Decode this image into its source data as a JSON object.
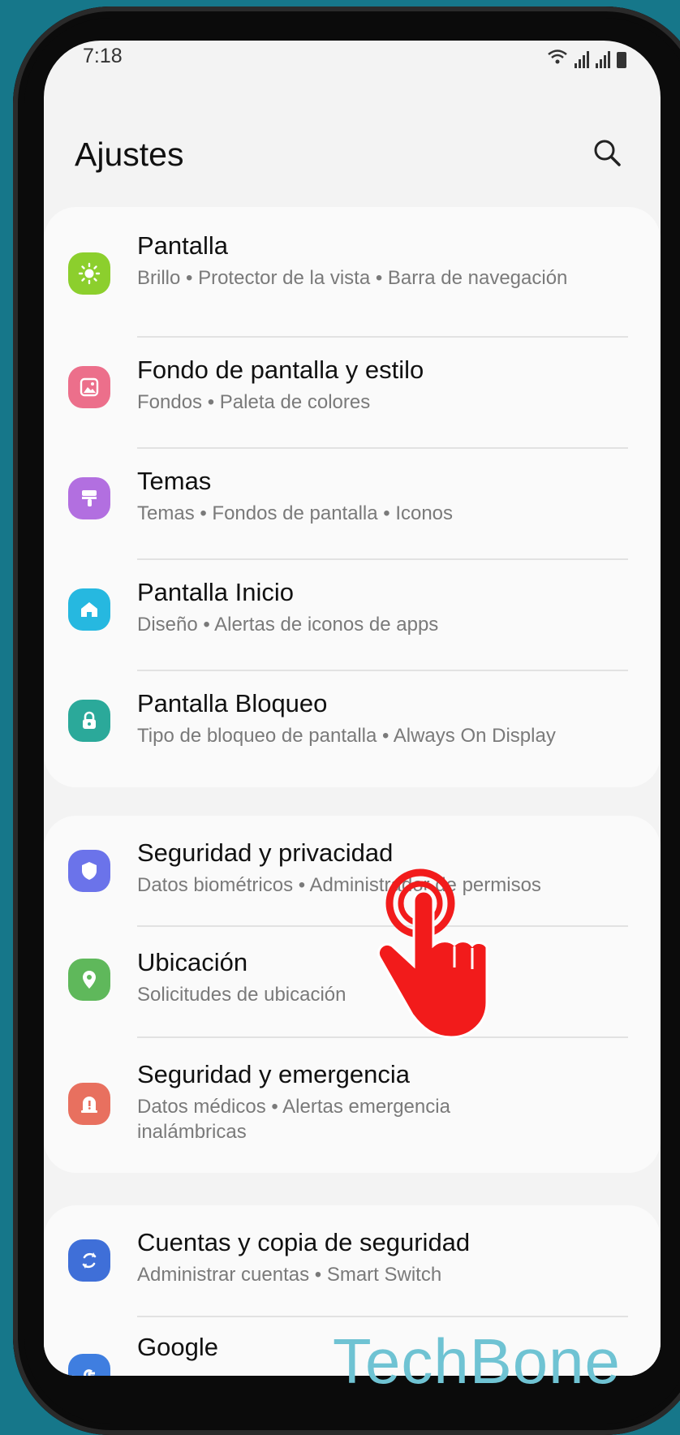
{
  "status": {
    "time": "7:18"
  },
  "header": {
    "title": "Ajustes"
  },
  "items": [
    {
      "title": "Pantalla",
      "subtitle": "Brillo • Protector de la vista • Barra de navegación",
      "icon": "sun-icon",
      "color": "#8ccf2d"
    },
    {
      "title": "Fondo de pantalla y estilo",
      "subtitle": "Fondos • Paleta de colores",
      "icon": "image-icon",
      "color": "#ec6f8b"
    },
    {
      "title": "Temas",
      "subtitle": "Temas • Fondos de pantalla • Iconos",
      "icon": "paintbrush-icon",
      "color": "#b26fe0"
    },
    {
      "title": "Pantalla Inicio",
      "subtitle": "Diseño • Alertas de iconos de apps",
      "icon": "home-icon",
      "color": "#26b8e0"
    },
    {
      "title": "Pantalla Bloqueo",
      "subtitle": "Tipo de bloqueo de pantalla • Always On Display",
      "icon": "lock-icon",
      "color": "#2ba99a"
    },
    {
      "title": "Seguridad y privacidad",
      "subtitle": "Datos biométricos • Administrador de permisos",
      "icon": "shield-icon",
      "color": "#6b73ea"
    },
    {
      "title": "Ubicación",
      "subtitle": "Solicitudes de ubicación",
      "icon": "location-pin-icon",
      "color": "#5fb85b"
    },
    {
      "title": "Seguridad y emergencia",
      "subtitle": "Datos médicos • Alertas emergencia inalámbricas",
      "icon": "alert-icon",
      "color": "#e8705f"
    },
    {
      "title": "Cuentas y copia de seguridad",
      "subtitle": "Administrar cuentas • Smart Switch",
      "icon": "sync-icon",
      "color": "#3f6fd8"
    },
    {
      "title": "Google",
      "subtitle": "",
      "icon": "google-icon",
      "color": "#3f7ee0"
    }
  ],
  "watermark": "TechBone"
}
